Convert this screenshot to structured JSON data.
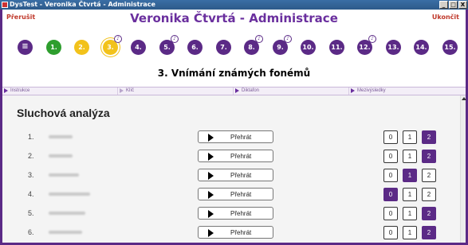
{
  "window": {
    "title": "DysTest - Veronika Čtvrtá - Administrace",
    "minimize": "_",
    "maximize": "□",
    "close": "X"
  },
  "header": {
    "interrupt_label": "Přerušit",
    "title": "Veronika Čtvrtá - Administrace",
    "finish_label": "Ukončit"
  },
  "steps": [
    {
      "label": "≡",
      "state": "menu"
    },
    {
      "label": "1.",
      "state": "done"
    },
    {
      "label": "2.",
      "state": "current"
    },
    {
      "label": "3.",
      "state": "active"
    },
    {
      "label": "4.",
      "state": "todo"
    },
    {
      "label": "5.",
      "state": "todo"
    },
    {
      "label": "6.",
      "state": "todo"
    },
    {
      "label": "7.",
      "state": "todo"
    },
    {
      "label": "8.",
      "state": "todo"
    },
    {
      "label": "9.",
      "state": "todo"
    },
    {
      "label": "10.",
      "state": "todo"
    },
    {
      "label": "11.",
      "state": "todo"
    },
    {
      "label": "12.",
      "state": "todo"
    },
    {
      "label": "13.",
      "state": "todo"
    },
    {
      "label": "14.",
      "state": "todo"
    },
    {
      "label": "15.",
      "state": "todo"
    }
  ],
  "subtitle": "3. Vnímání známých fonémů",
  "tabs": [
    {
      "label": "Instrukce"
    },
    {
      "label": "Klíč"
    },
    {
      "label": "Diktafon"
    },
    {
      "label": "Mezivýsledky"
    }
  ],
  "section_title": "Sluchová analýza",
  "play_label": "Přehrát",
  "score_options": [
    "0",
    "1",
    "2"
  ],
  "rows": [
    {
      "num": "1.",
      "selected": 2
    },
    {
      "num": "2.",
      "selected": 2
    },
    {
      "num": "3.",
      "selected": 1
    },
    {
      "num": "4.",
      "selected": 0
    },
    {
      "num": "5.",
      "selected": 2
    },
    {
      "num": "6.",
      "selected": 2
    }
  ],
  "colors": {
    "accent": "#5b2a86",
    "done": "#2e9e2e",
    "current": "#f2c21b",
    "danger": "#c0392b"
  }
}
